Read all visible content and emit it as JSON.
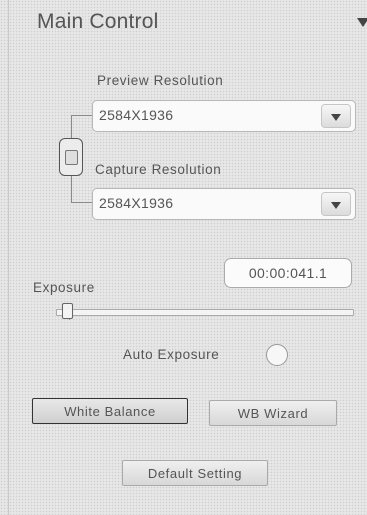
{
  "panel": {
    "title": "Main Control"
  },
  "preview": {
    "label": "Preview Resolution",
    "value": "2584X1936"
  },
  "capture": {
    "label": "Capture Resolution",
    "value": "2584X1936"
  },
  "exposure": {
    "label": "Exposure",
    "time": "00:00:041.1",
    "level": 0.02
  },
  "auto_exposure": {
    "label": "Auto Exposure"
  },
  "buttons": {
    "white_balance": "White Balance",
    "wb_wizard": "WB Wizard",
    "default_setting": "Default Setting"
  }
}
